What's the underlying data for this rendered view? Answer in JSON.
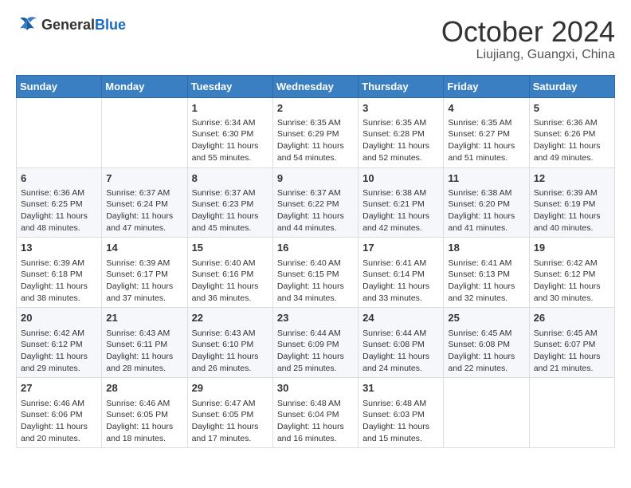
{
  "header": {
    "logo_general": "General",
    "logo_blue": "Blue",
    "month_title": "October 2024",
    "location": "Liujiang, Guangxi, China"
  },
  "weekdays": [
    "Sunday",
    "Monday",
    "Tuesday",
    "Wednesday",
    "Thursday",
    "Friday",
    "Saturday"
  ],
  "weeks": [
    [
      {
        "day": "",
        "sunrise": "",
        "sunset": "",
        "daylight": ""
      },
      {
        "day": "",
        "sunrise": "",
        "sunset": "",
        "daylight": ""
      },
      {
        "day": "1",
        "sunrise": "Sunrise: 6:34 AM",
        "sunset": "Sunset: 6:30 PM",
        "daylight": "Daylight: 11 hours and 55 minutes."
      },
      {
        "day": "2",
        "sunrise": "Sunrise: 6:35 AM",
        "sunset": "Sunset: 6:29 PM",
        "daylight": "Daylight: 11 hours and 54 minutes."
      },
      {
        "day": "3",
        "sunrise": "Sunrise: 6:35 AM",
        "sunset": "Sunset: 6:28 PM",
        "daylight": "Daylight: 11 hours and 52 minutes."
      },
      {
        "day": "4",
        "sunrise": "Sunrise: 6:35 AM",
        "sunset": "Sunset: 6:27 PM",
        "daylight": "Daylight: 11 hours and 51 minutes."
      },
      {
        "day": "5",
        "sunrise": "Sunrise: 6:36 AM",
        "sunset": "Sunset: 6:26 PM",
        "daylight": "Daylight: 11 hours and 49 minutes."
      }
    ],
    [
      {
        "day": "6",
        "sunrise": "Sunrise: 6:36 AM",
        "sunset": "Sunset: 6:25 PM",
        "daylight": "Daylight: 11 hours and 48 minutes."
      },
      {
        "day": "7",
        "sunrise": "Sunrise: 6:37 AM",
        "sunset": "Sunset: 6:24 PM",
        "daylight": "Daylight: 11 hours and 47 minutes."
      },
      {
        "day": "8",
        "sunrise": "Sunrise: 6:37 AM",
        "sunset": "Sunset: 6:23 PM",
        "daylight": "Daylight: 11 hours and 45 minutes."
      },
      {
        "day": "9",
        "sunrise": "Sunrise: 6:37 AM",
        "sunset": "Sunset: 6:22 PM",
        "daylight": "Daylight: 11 hours and 44 minutes."
      },
      {
        "day": "10",
        "sunrise": "Sunrise: 6:38 AM",
        "sunset": "Sunset: 6:21 PM",
        "daylight": "Daylight: 11 hours and 42 minutes."
      },
      {
        "day": "11",
        "sunrise": "Sunrise: 6:38 AM",
        "sunset": "Sunset: 6:20 PM",
        "daylight": "Daylight: 11 hours and 41 minutes."
      },
      {
        "day": "12",
        "sunrise": "Sunrise: 6:39 AM",
        "sunset": "Sunset: 6:19 PM",
        "daylight": "Daylight: 11 hours and 40 minutes."
      }
    ],
    [
      {
        "day": "13",
        "sunrise": "Sunrise: 6:39 AM",
        "sunset": "Sunset: 6:18 PM",
        "daylight": "Daylight: 11 hours and 38 minutes."
      },
      {
        "day": "14",
        "sunrise": "Sunrise: 6:39 AM",
        "sunset": "Sunset: 6:17 PM",
        "daylight": "Daylight: 11 hours and 37 minutes."
      },
      {
        "day": "15",
        "sunrise": "Sunrise: 6:40 AM",
        "sunset": "Sunset: 6:16 PM",
        "daylight": "Daylight: 11 hours and 36 minutes."
      },
      {
        "day": "16",
        "sunrise": "Sunrise: 6:40 AM",
        "sunset": "Sunset: 6:15 PM",
        "daylight": "Daylight: 11 hours and 34 minutes."
      },
      {
        "day": "17",
        "sunrise": "Sunrise: 6:41 AM",
        "sunset": "Sunset: 6:14 PM",
        "daylight": "Daylight: 11 hours and 33 minutes."
      },
      {
        "day": "18",
        "sunrise": "Sunrise: 6:41 AM",
        "sunset": "Sunset: 6:13 PM",
        "daylight": "Daylight: 11 hours and 32 minutes."
      },
      {
        "day": "19",
        "sunrise": "Sunrise: 6:42 AM",
        "sunset": "Sunset: 6:12 PM",
        "daylight": "Daylight: 11 hours and 30 minutes."
      }
    ],
    [
      {
        "day": "20",
        "sunrise": "Sunrise: 6:42 AM",
        "sunset": "Sunset: 6:12 PM",
        "daylight": "Daylight: 11 hours and 29 minutes."
      },
      {
        "day": "21",
        "sunrise": "Sunrise: 6:43 AM",
        "sunset": "Sunset: 6:11 PM",
        "daylight": "Daylight: 11 hours and 28 minutes."
      },
      {
        "day": "22",
        "sunrise": "Sunrise: 6:43 AM",
        "sunset": "Sunset: 6:10 PM",
        "daylight": "Daylight: 11 hours and 26 minutes."
      },
      {
        "day": "23",
        "sunrise": "Sunrise: 6:44 AM",
        "sunset": "Sunset: 6:09 PM",
        "daylight": "Daylight: 11 hours and 25 minutes."
      },
      {
        "day": "24",
        "sunrise": "Sunrise: 6:44 AM",
        "sunset": "Sunset: 6:08 PM",
        "daylight": "Daylight: 11 hours and 24 minutes."
      },
      {
        "day": "25",
        "sunrise": "Sunrise: 6:45 AM",
        "sunset": "Sunset: 6:08 PM",
        "daylight": "Daylight: 11 hours and 22 minutes."
      },
      {
        "day": "26",
        "sunrise": "Sunrise: 6:45 AM",
        "sunset": "Sunset: 6:07 PM",
        "daylight": "Daylight: 11 hours and 21 minutes."
      }
    ],
    [
      {
        "day": "27",
        "sunrise": "Sunrise: 6:46 AM",
        "sunset": "Sunset: 6:06 PM",
        "daylight": "Daylight: 11 hours and 20 minutes."
      },
      {
        "day": "28",
        "sunrise": "Sunrise: 6:46 AM",
        "sunset": "Sunset: 6:05 PM",
        "daylight": "Daylight: 11 hours and 18 minutes."
      },
      {
        "day": "29",
        "sunrise": "Sunrise: 6:47 AM",
        "sunset": "Sunset: 6:05 PM",
        "daylight": "Daylight: 11 hours and 17 minutes."
      },
      {
        "day": "30",
        "sunrise": "Sunrise: 6:48 AM",
        "sunset": "Sunset: 6:04 PM",
        "daylight": "Daylight: 11 hours and 16 minutes."
      },
      {
        "day": "31",
        "sunrise": "Sunrise: 6:48 AM",
        "sunset": "Sunset: 6:03 PM",
        "daylight": "Daylight: 11 hours and 15 minutes."
      },
      {
        "day": "",
        "sunrise": "",
        "sunset": "",
        "daylight": ""
      },
      {
        "day": "",
        "sunrise": "",
        "sunset": "",
        "daylight": ""
      }
    ]
  ]
}
